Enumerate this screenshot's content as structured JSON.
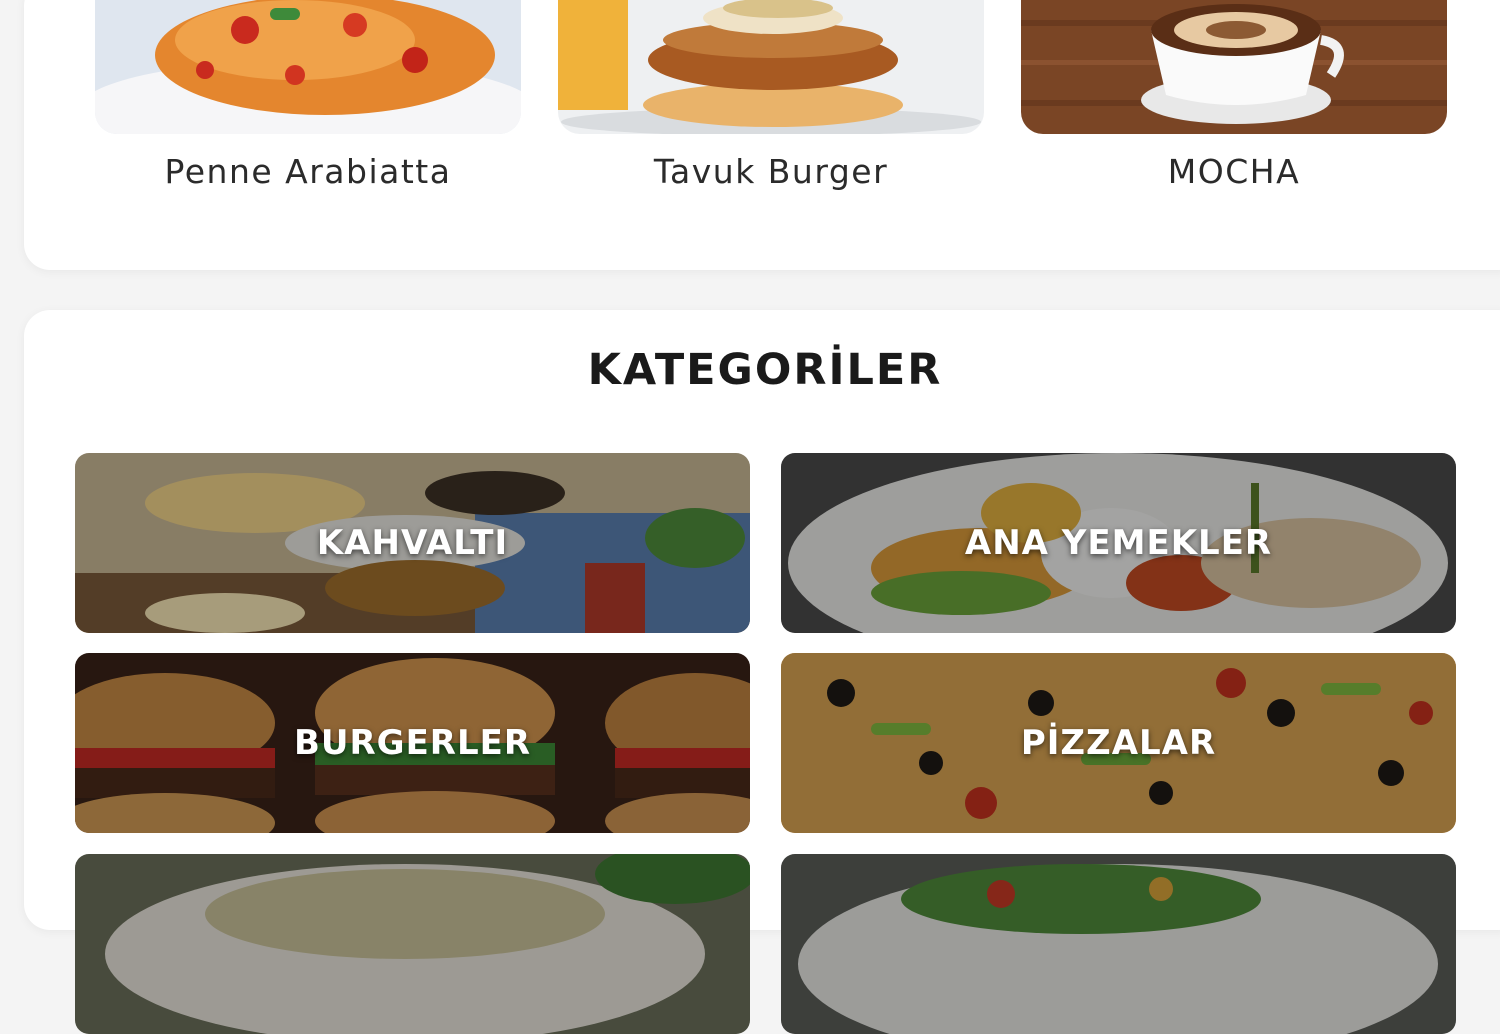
{
  "featured": {
    "items": [
      {
        "label": "Penne Arabiatta",
        "image": "penne-pasta-photo"
      },
      {
        "label": "Tavuk Burger",
        "image": "chicken-burger-photo"
      },
      {
        "label": "MOCHA",
        "image": "mocha-coffee-photo"
      }
    ]
  },
  "categories": {
    "title": "KATEGORİLER",
    "items": [
      {
        "label": "KAHVALTI",
        "image": "breakfast-photo"
      },
      {
        "label": "ANA YEMEKLER",
        "image": "main-dishes-photo"
      },
      {
        "label": "BURGERLER",
        "image": "burgers-photo"
      },
      {
        "label": "PİZZALAR",
        "image": "pizzas-photo"
      },
      {
        "label": "",
        "image": "salad-bowl-photo"
      },
      {
        "label": "",
        "image": "salad-plate-photo"
      }
    ]
  }
}
